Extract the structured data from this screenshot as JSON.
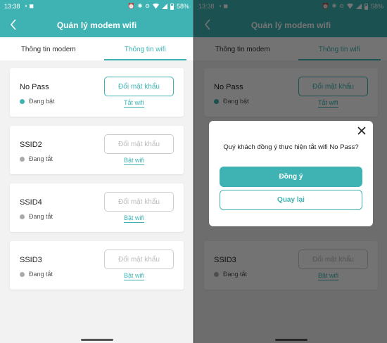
{
  "status_bar": {
    "time": "13:38",
    "battery": "58%"
  },
  "header": {
    "title": "Quản lý modem wifi"
  },
  "tabs": [
    {
      "label": "Thông tin modem",
      "active": false
    },
    {
      "label": "Thông tin wifi",
      "active": true
    }
  ],
  "wifi_list": [
    {
      "name": "No Pass",
      "status": "Đang bật",
      "on": true,
      "change_password": "Đổi mật khẩu",
      "toggle": "Tắt wifi"
    },
    {
      "name": "SSID2",
      "status": "Đang tắt",
      "on": false,
      "change_password": "Đổi mật khẩu",
      "toggle": "Bật wifi"
    },
    {
      "name": "SSID4",
      "status": "Đang tắt",
      "on": false,
      "change_password": "Đổi mật khẩu",
      "toggle": "Bật wifi"
    },
    {
      "name": "SSID3",
      "status": "Đang tắt",
      "on": false,
      "change_password": "Đổi mật khẩu",
      "toggle": "Bật wifi"
    }
  ],
  "dialog": {
    "message": "Quý khách đồng ý thực hiện tắt wifi No Pass?",
    "confirm_label": "Đồng ý",
    "back_label": "Quay lại"
  },
  "colors": {
    "accent": "#3fb3b3",
    "off_dot": "#aaaaaa"
  }
}
